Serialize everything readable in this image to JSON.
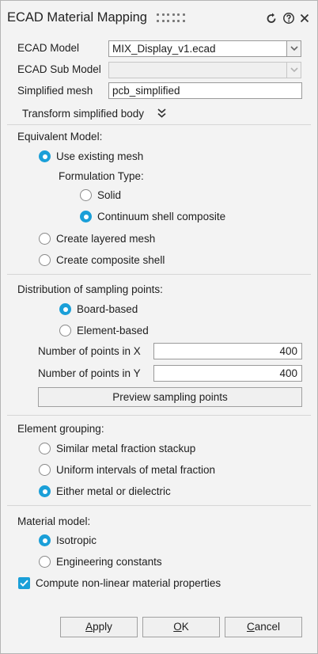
{
  "window": {
    "title": "ECAD Material Mapping",
    "icons": [
      "drag-grip-icon",
      "reset-icon",
      "help-icon",
      "close-icon"
    ]
  },
  "ecad_model": {
    "label": "ECAD Model",
    "value": "MIX_Display_v1.ecad"
  },
  "ecad_sub_model": {
    "label": "ECAD Sub Model",
    "value": ""
  },
  "simplified_mesh": {
    "label": "Simplified mesh",
    "value": "pcb_simplified"
  },
  "transform": {
    "label": "Transform simplified body",
    "icon": "double-chevron-down-icon"
  },
  "equivalent_model": {
    "heading": "Equivalent Model:",
    "use_existing_mesh": "Use existing mesh",
    "formulation_heading": "Formulation Type:",
    "solid": "Solid",
    "continuum_shell": "Continuum shell composite",
    "create_layered_mesh": "Create layered mesh",
    "create_composite_shell": "Create composite shell",
    "selected": "Use existing mesh",
    "formulation_selected": "Continuum shell composite"
  },
  "distribution": {
    "heading": "Distribution of sampling points:",
    "board_based": "Board-based",
    "element_based": "Element-based",
    "selected": "Board-based",
    "points_x_label": "Number of points in X",
    "points_x_value": "400",
    "points_y_label": "Number of points in Y",
    "points_y_value": "400",
    "preview_button": "Preview sampling points"
  },
  "element_grouping": {
    "heading": "Element grouping:",
    "similar": "Similar metal fraction stackup",
    "uniform": "Uniform intervals of metal fraction",
    "either": "Either metal or dielectric",
    "selected": "Either metal or dielectric"
  },
  "material_model": {
    "heading": "Material model:",
    "isotropic": "Isotropic",
    "engineering": "Engineering constants",
    "selected": "Isotropic",
    "compute_nonlinear": "Compute non-linear material properties",
    "compute_nonlinear_checked": true
  },
  "buttons": {
    "apply_mnemonic": "A",
    "apply_rest": "pply",
    "ok_mnemonic": "O",
    "ok_rest": "K",
    "cancel_mnemonic": "C",
    "cancel_rest": "ancel"
  },
  "colors": {
    "accent": "#1a9fd8",
    "panel": "#f3f3f3",
    "border": "#9a9a9a"
  }
}
